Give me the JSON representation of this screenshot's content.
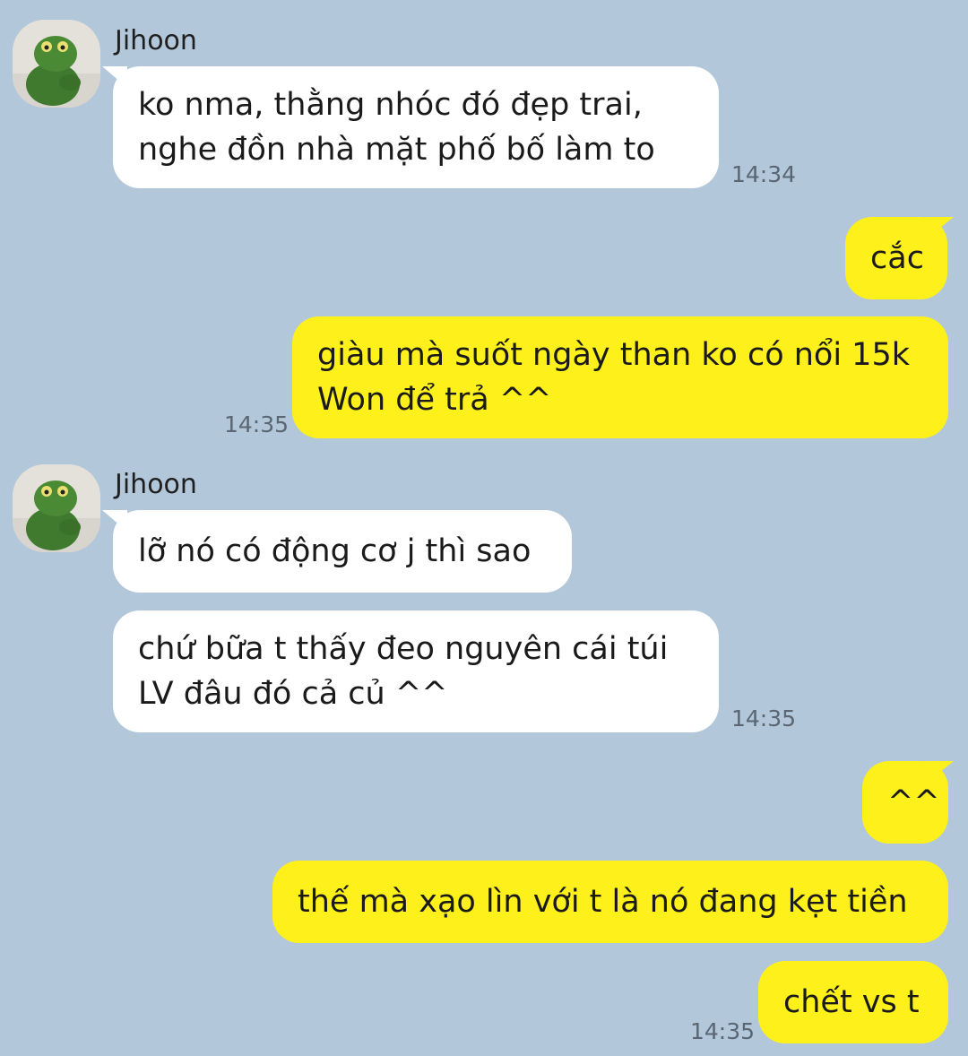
{
  "chat": {
    "sender_name": "Jihoon",
    "group1": {
      "name": "Jihoon",
      "bubble1": "ko nma, thằng nhóc đó đẹp trai,\nnghe đồn nhà mặt phố bố làm to",
      "time": "14:34"
    },
    "out1": {
      "bubble1": "cắc",
      "bubble2": "giàu mà suốt ngày than ko có nổi 15k\nWon để trả ^^",
      "time": "14:35"
    },
    "group2": {
      "name": "Jihoon",
      "bubble1": "lỡ nó có động cơ j thì sao",
      "bubble2": "chứ bữa t thấy đeo nguyên cái túi\nLV đâu đó cả củ ^^",
      "time": "14:35"
    },
    "out2": {
      "bubble1": "^^",
      "bubble2": "thế mà xạo lìn với t là nó đang kẹt tiền",
      "bubble3": "chết vs t",
      "time": "14:35"
    }
  },
  "colors": {
    "background": "#b2c7d9",
    "incoming_bubble": "#ffffff",
    "outgoing_bubble": "#fef01b"
  },
  "icons": {
    "avatar": "green-knit-frog-avatar"
  }
}
